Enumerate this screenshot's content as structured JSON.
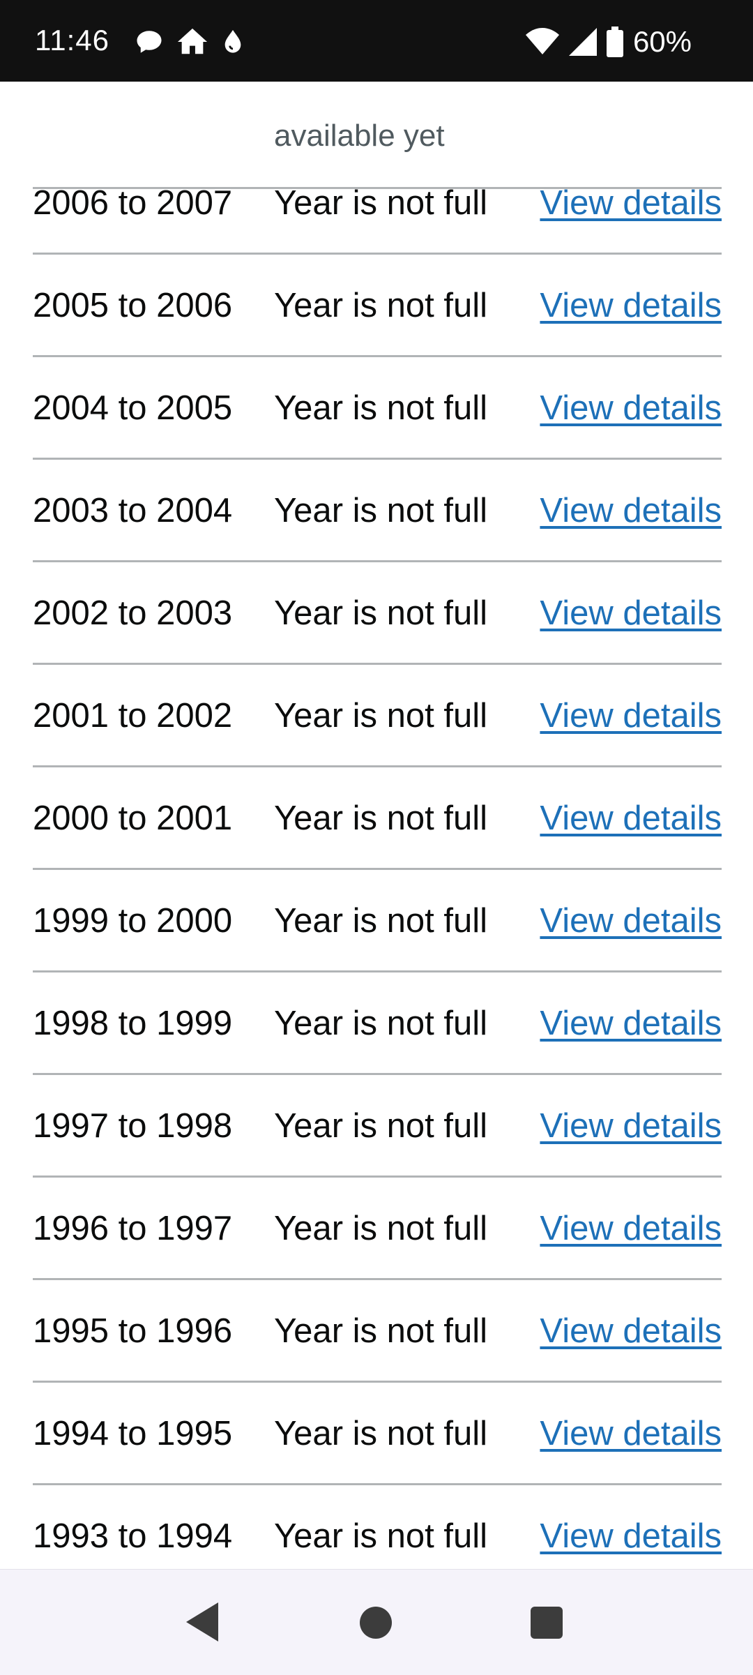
{
  "status_bar": {
    "time": "11:46",
    "battery": "60%",
    "icons_left": [
      "chat-bubble-icon",
      "home-icon",
      "drop-icon"
    ],
    "icons_right": [
      "wifi-icon",
      "cellular-signal-icon",
      "battery-icon"
    ]
  },
  "partial_row": {
    "status": "available yet"
  },
  "rows": [
    {
      "year": "2006 to 2007",
      "status": "Year is not full",
      "link": "View details"
    },
    {
      "year": "2005 to 2006",
      "status": "Year is not full",
      "link": "View details"
    },
    {
      "year": "2004 to 2005",
      "status": "Year is not full",
      "link": "View details"
    },
    {
      "year": "2003 to 2004",
      "status": "Year is not full",
      "link": "View details"
    },
    {
      "year": "2002 to 2003",
      "status": "Year is not full",
      "link": "View details"
    },
    {
      "year": "2001 to 2002",
      "status": "Year is not full",
      "link": "View details"
    },
    {
      "year": "2000 to 2001",
      "status": "Year is not full",
      "link": "View details"
    },
    {
      "year": "1999 to 2000",
      "status": "Year is not full",
      "link": "View details"
    },
    {
      "year": "1998 to 1999",
      "status": "Year is not full",
      "link": "View details"
    },
    {
      "year": "1997 to 1998",
      "status": "Year is not full",
      "link": "View details"
    },
    {
      "year": "1996 to 1997",
      "status": "Year is not full",
      "link": "View details"
    },
    {
      "year": "1995 to 1996",
      "status": "Year is not full",
      "link": "View details"
    },
    {
      "year": "1994 to 1995",
      "status": "Year is not full",
      "link": "View details"
    },
    {
      "year": "1993 to 1994",
      "status": "Year is not full",
      "link": "View details"
    }
  ],
  "nav_bar": {
    "icons": [
      "back-icon",
      "home-circle-icon",
      "recents-icon"
    ]
  },
  "colors": {
    "link": "#1d70b8",
    "text": "#0b0c0c",
    "divider": "#b1b4b6",
    "muted": "#505a5f"
  }
}
